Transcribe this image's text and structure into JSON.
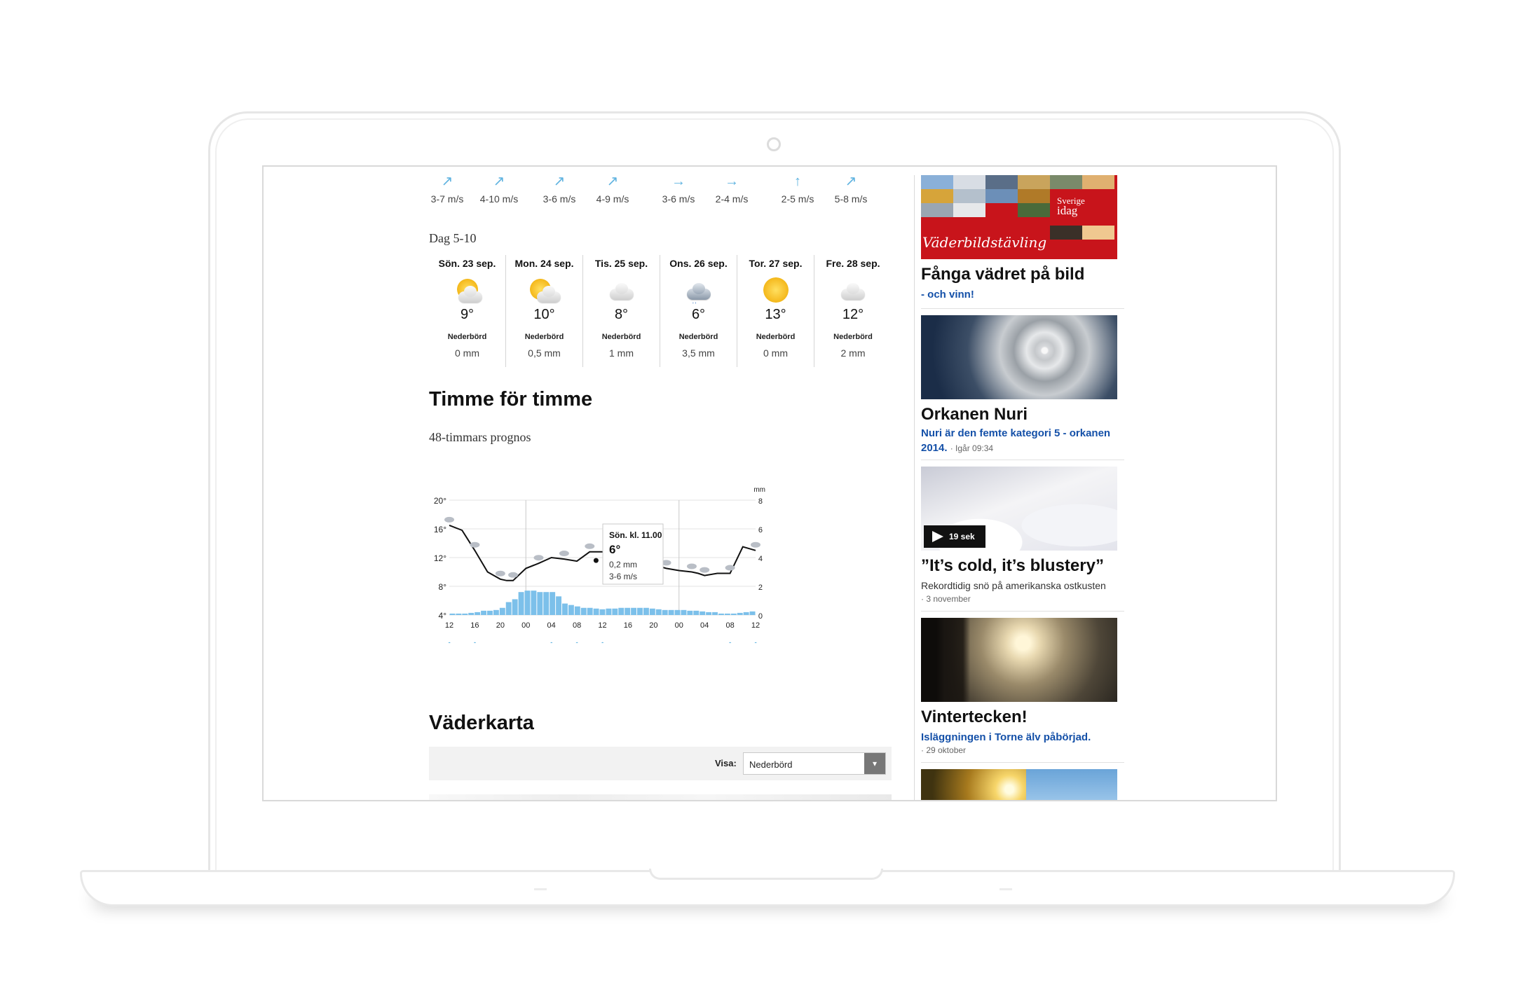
{
  "wind": [
    {
      "arrow": "↗",
      "speed": "3-7 m/s"
    },
    {
      "arrow": "↗",
      "speed": "4-10 m/s"
    },
    {
      "arrow": "↗",
      "speed": "3-6 m/s"
    },
    {
      "arrow": "↗",
      "speed": "4-9 m/s"
    },
    {
      "arrow": "→",
      "speed": "3-6 m/s"
    },
    {
      "arrow": "→",
      "speed": "2-4 m/s"
    },
    {
      "arrow": "↑",
      "speed": "2-5 m/s"
    },
    {
      "arrow": "↗",
      "speed": "5-8 m/s"
    }
  ],
  "forecast": {
    "range_label": "Dag 5-10",
    "days": [
      {
        "name": "Sön. 23 sep.",
        "icon": "sun-cloud-icon",
        "temp": "9°",
        "precip_label": "Nederbörd",
        "precip": "0 mm"
      },
      {
        "name": "Mon. 24 sep.",
        "icon": "sun-cloud-icon",
        "temp": "10°",
        "precip_label": "Nederbörd",
        "precip": "0,5 mm"
      },
      {
        "name": "Tis. 25 sep.",
        "icon": "cloud-icon",
        "temp": "8°",
        "precip_label": "Nederbörd",
        "precip": "1 mm"
      },
      {
        "name": "Ons. 26 sep.",
        "icon": "rain-cloud-icon",
        "temp": "6°",
        "precip_label": "Nederbörd",
        "precip": "3,5 mm"
      },
      {
        "name": "Tor. 27 sep.",
        "icon": "sun-icon",
        "temp": "13°",
        "precip_label": "Nederbörd",
        "precip": "0 mm"
      },
      {
        "name": "Fre. 28 sep.",
        "icon": "cloud-icon",
        "temp": "12°",
        "precip_label": "Nederbörd",
        "precip": "2 mm"
      }
    ]
  },
  "hourly": {
    "title": "Timme för timme",
    "subtitle": "48-timmars prognos"
  },
  "chart_data": {
    "type": "line",
    "x_ticks": [
      "12",
      "16",
      "20",
      "00",
      "04",
      "08",
      "12",
      "16",
      "20",
      "00",
      "04",
      "08",
      "12"
    ],
    "y_left_ticks": [
      "20°",
      "16°",
      "12°",
      "8°",
      "4°"
    ],
    "y_left_range": [
      4,
      20
    ],
    "y_right_unit": "mm",
    "y_right_ticks": [
      "8",
      "6",
      "4",
      "2",
      "0"
    ],
    "y_right_range": [
      0,
      8
    ],
    "grid": true,
    "series": [
      {
        "kind": "line",
        "x_hours": [
          0,
          2,
          4,
          6,
          8,
          9,
          10,
          12,
          14,
          16,
          18,
          20,
          22,
          24,
          26,
          28,
          30,
          32,
          34,
          36,
          38,
          39,
          40,
          42,
          44,
          46,
          48
        ],
        "values": [
          16.5,
          15.8,
          13,
          10,
          9,
          8.8,
          8.8,
          10.5,
          11.2,
          12,
          11.8,
          11.5,
          12.8,
          12.8,
          11.5,
          11.0,
          10.8,
          11.0,
          10.5,
          10.2,
          10,
          9.8,
          9.5,
          9.8,
          9.8,
          13.5,
          13.0
        ]
      },
      {
        "kind": "bar",
        "values": [
          0.1,
          0.1,
          0.1,
          0.15,
          0.2,
          0.3,
          0.3,
          0.35,
          0.5,
          0.9,
          1.1,
          1.6,
          1.7,
          1.7,
          1.6,
          1.6,
          1.6,
          1.3,
          0.8,
          0.7,
          0.6,
          0.5,
          0.5,
          0.45,
          0.4,
          0.45,
          0.45,
          0.5,
          0.5,
          0.5,
          0.5,
          0.5,
          0.45,
          0.4,
          0.35,
          0.35,
          0.35,
          0.35,
          0.3,
          0.3,
          0.25,
          0.2,
          0.2,
          0.1,
          0.1,
          0.1,
          0.15,
          0.2,
          0.25
        ]
      }
    ],
    "tooltip": {
      "title": "Sön. kl. 11.00",
      "temp": "6°",
      "precip": "0,2 mm",
      "wind": "3-6 m/s"
    },
    "wind_arrows": [
      "↕",
      "↕",
      "↔",
      "↘",
      "↕",
      "↕",
      "↕",
      "↖",
      "↔",
      "↔",
      "↗",
      "↕",
      "↕"
    ]
  },
  "map": {
    "title": "Väderkarta",
    "show_label": "Visa:",
    "selected": "Nederbörd"
  },
  "sidebar": {
    "cards": [
      {
        "title": "Fånga vädret på bild",
        "link": "- och vinn!",
        "banner": "Väderbildstävling",
        "brand_top": "Sverige",
        "brand_bottom": "idag"
      },
      {
        "title": "Orkanen Nuri",
        "link": "Nuri är den femte kategori 5 - orkanen 2014.",
        "meta": "· Igår 09:34"
      },
      {
        "title": "”It’s cold, it’s blustery”",
        "text": "Rekordtidig snö på amerikanska ostkusten",
        "meta": "· 3 november",
        "badge": "19 sek"
      },
      {
        "title": "Vintertecken!",
        "link": "Isläggningen i Torne älv påbörjad.",
        "meta": "· 29 oktober"
      }
    ]
  }
}
